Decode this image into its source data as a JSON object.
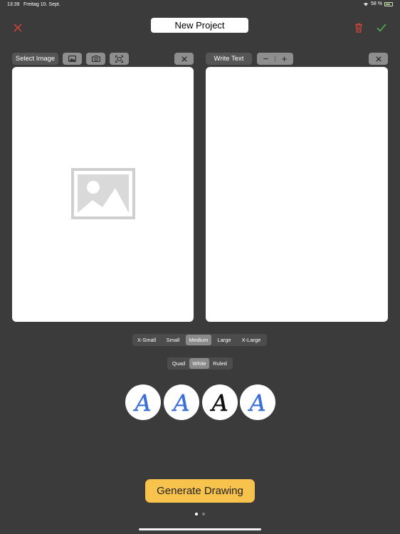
{
  "status_bar": {
    "time": "13:39",
    "date": "Freitag 10. Sept.",
    "battery": "58 %"
  },
  "header": {
    "title": "New Project",
    "close_icon": "x-icon",
    "trash_icon": "trash-icon",
    "confirm_icon": "checkmark-icon"
  },
  "image_toolbar": {
    "label": "Select Image",
    "icons": [
      "photo-library-icon",
      "camera-icon",
      "scan-icon"
    ],
    "clear_icon": "x-icon"
  },
  "text_toolbar": {
    "label": "Write Text",
    "minus": "−",
    "plus": "+",
    "clear_icon": "x-icon"
  },
  "size_options": {
    "items": [
      "X-Small",
      "Small",
      "Medium",
      "Large",
      "X-Large"
    ],
    "selected": "Medium"
  },
  "paper_options": {
    "items": [
      "Quad",
      "White",
      "Ruled"
    ],
    "selected": "White"
  },
  "font_styles": {
    "glyph": "A",
    "colors": [
      "#3a6fd8",
      "#3a6fd8",
      "#111111",
      "#3a6fd8"
    ]
  },
  "actions": {
    "generate_label": "Generate Drawing"
  },
  "pager": {
    "count": 2,
    "active": 1
  },
  "colors": {
    "background": "#3b3b3b",
    "accent": "#f8c34c",
    "destructive": "#d9453b",
    "confirm": "#4caf50"
  }
}
